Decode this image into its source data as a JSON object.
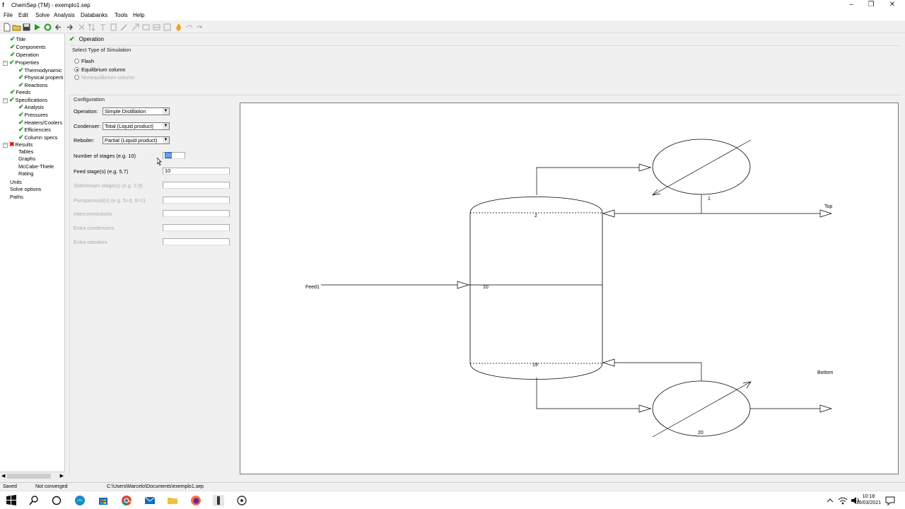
{
  "window": {
    "title": "ChemSep (TM) - exemplo1.sep"
  },
  "menu": [
    "File",
    "Edit",
    "Solve",
    "Analysis",
    "Databanks",
    "Tools",
    "Help"
  ],
  "tree": {
    "items": [
      {
        "label": "Title",
        "level": 1,
        "status": "ok"
      },
      {
        "label": "Components",
        "level": 1,
        "status": "ok"
      },
      {
        "label": "Operation",
        "level": 1,
        "status": "ok"
      },
      {
        "label": "Properties",
        "level": 1,
        "status": "ok",
        "expander": "−"
      },
      {
        "label": "Thermodynamic",
        "level": 2,
        "status": "ok"
      },
      {
        "label": "Physical properti",
        "level": 2,
        "status": "ok"
      },
      {
        "label": "Reactions",
        "level": 2,
        "status": "ok"
      },
      {
        "label": "Feeds",
        "level": 1,
        "status": "ok"
      },
      {
        "label": "Specifications",
        "level": 1,
        "status": "ok",
        "expander": "−"
      },
      {
        "label": "Analysis",
        "level": 2,
        "status": "ok"
      },
      {
        "label": "Pressures",
        "level": 2,
        "status": "ok"
      },
      {
        "label": "Heaters/Coolers",
        "level": 2,
        "status": "ok"
      },
      {
        "label": "Efficiencies",
        "level": 2,
        "status": "ok"
      },
      {
        "label": "Column specs",
        "level": 2,
        "status": "ok"
      },
      {
        "label": "Results",
        "level": 1,
        "status": "error",
        "expander": "−"
      },
      {
        "label": "Tables",
        "level": 2,
        "status": "none"
      },
      {
        "label": "Graphs",
        "level": 2,
        "status": "none"
      },
      {
        "label": "McCabe-Thiele",
        "level": 2,
        "status": "none"
      },
      {
        "label": "Rating",
        "level": 2,
        "status": "none"
      },
      {
        "label": "Units",
        "level": 0,
        "status": "none"
      },
      {
        "label": "Solve options",
        "level": 0,
        "status": "none"
      },
      {
        "label": "Paths",
        "level": 0,
        "status": "none"
      }
    ]
  },
  "tab": {
    "label": "Operation"
  },
  "simulation": {
    "group_label": "Select Type of Simulation",
    "options": [
      {
        "label": "Flash",
        "selected": false,
        "enabled": true
      },
      {
        "label": "Equilibrium column",
        "selected": true,
        "enabled": true
      },
      {
        "label": "Nonequilibrium column",
        "selected": false,
        "enabled": false
      }
    ]
  },
  "config": {
    "group_label": "Configuration",
    "operation": {
      "label": "Operation:",
      "value": "Simple Distillation"
    },
    "condenser": {
      "label": "Condenser:",
      "value": "Total (Liquid product)"
    },
    "reboiler": {
      "label": "Reboiler:",
      "value": "Partial (Liquid product)"
    },
    "stages": {
      "label": "Number of stages (e.g. 10)",
      "value": "20"
    },
    "feed_stages": {
      "label": "Feed stage(s) (e.g. 5,7)",
      "value": "10"
    },
    "sidestream": {
      "label": "Sidestream stage(s) (e.g. 2,9)",
      "value": ""
    },
    "pumparounds": {
      "label": "Pumparound(s) (e.g. 5>3, 9>1)",
      "value": ""
    },
    "interconnections": {
      "label": "Interconnections",
      "value": ""
    },
    "extra_condensers": {
      "label": "Extra condensers",
      "value": ""
    },
    "extra_reboilers": {
      "label": "Extra reboilers",
      "value": ""
    }
  },
  "diagram": {
    "feed_label": "Feed1",
    "top_label": "Top",
    "bottom_label": "Bottom",
    "stage_top": "2",
    "stage_feed": "10",
    "stage_bottom": "19",
    "condenser_stage": "1",
    "reboiler_stage": "20"
  },
  "status": {
    "saved": "Saved",
    "converged": "Not converged",
    "path": "C:\\Users\\Marcelo\\Documents\\exemplo1.sep"
  },
  "clock": {
    "time": "10:18",
    "date": "16/03/2021"
  }
}
